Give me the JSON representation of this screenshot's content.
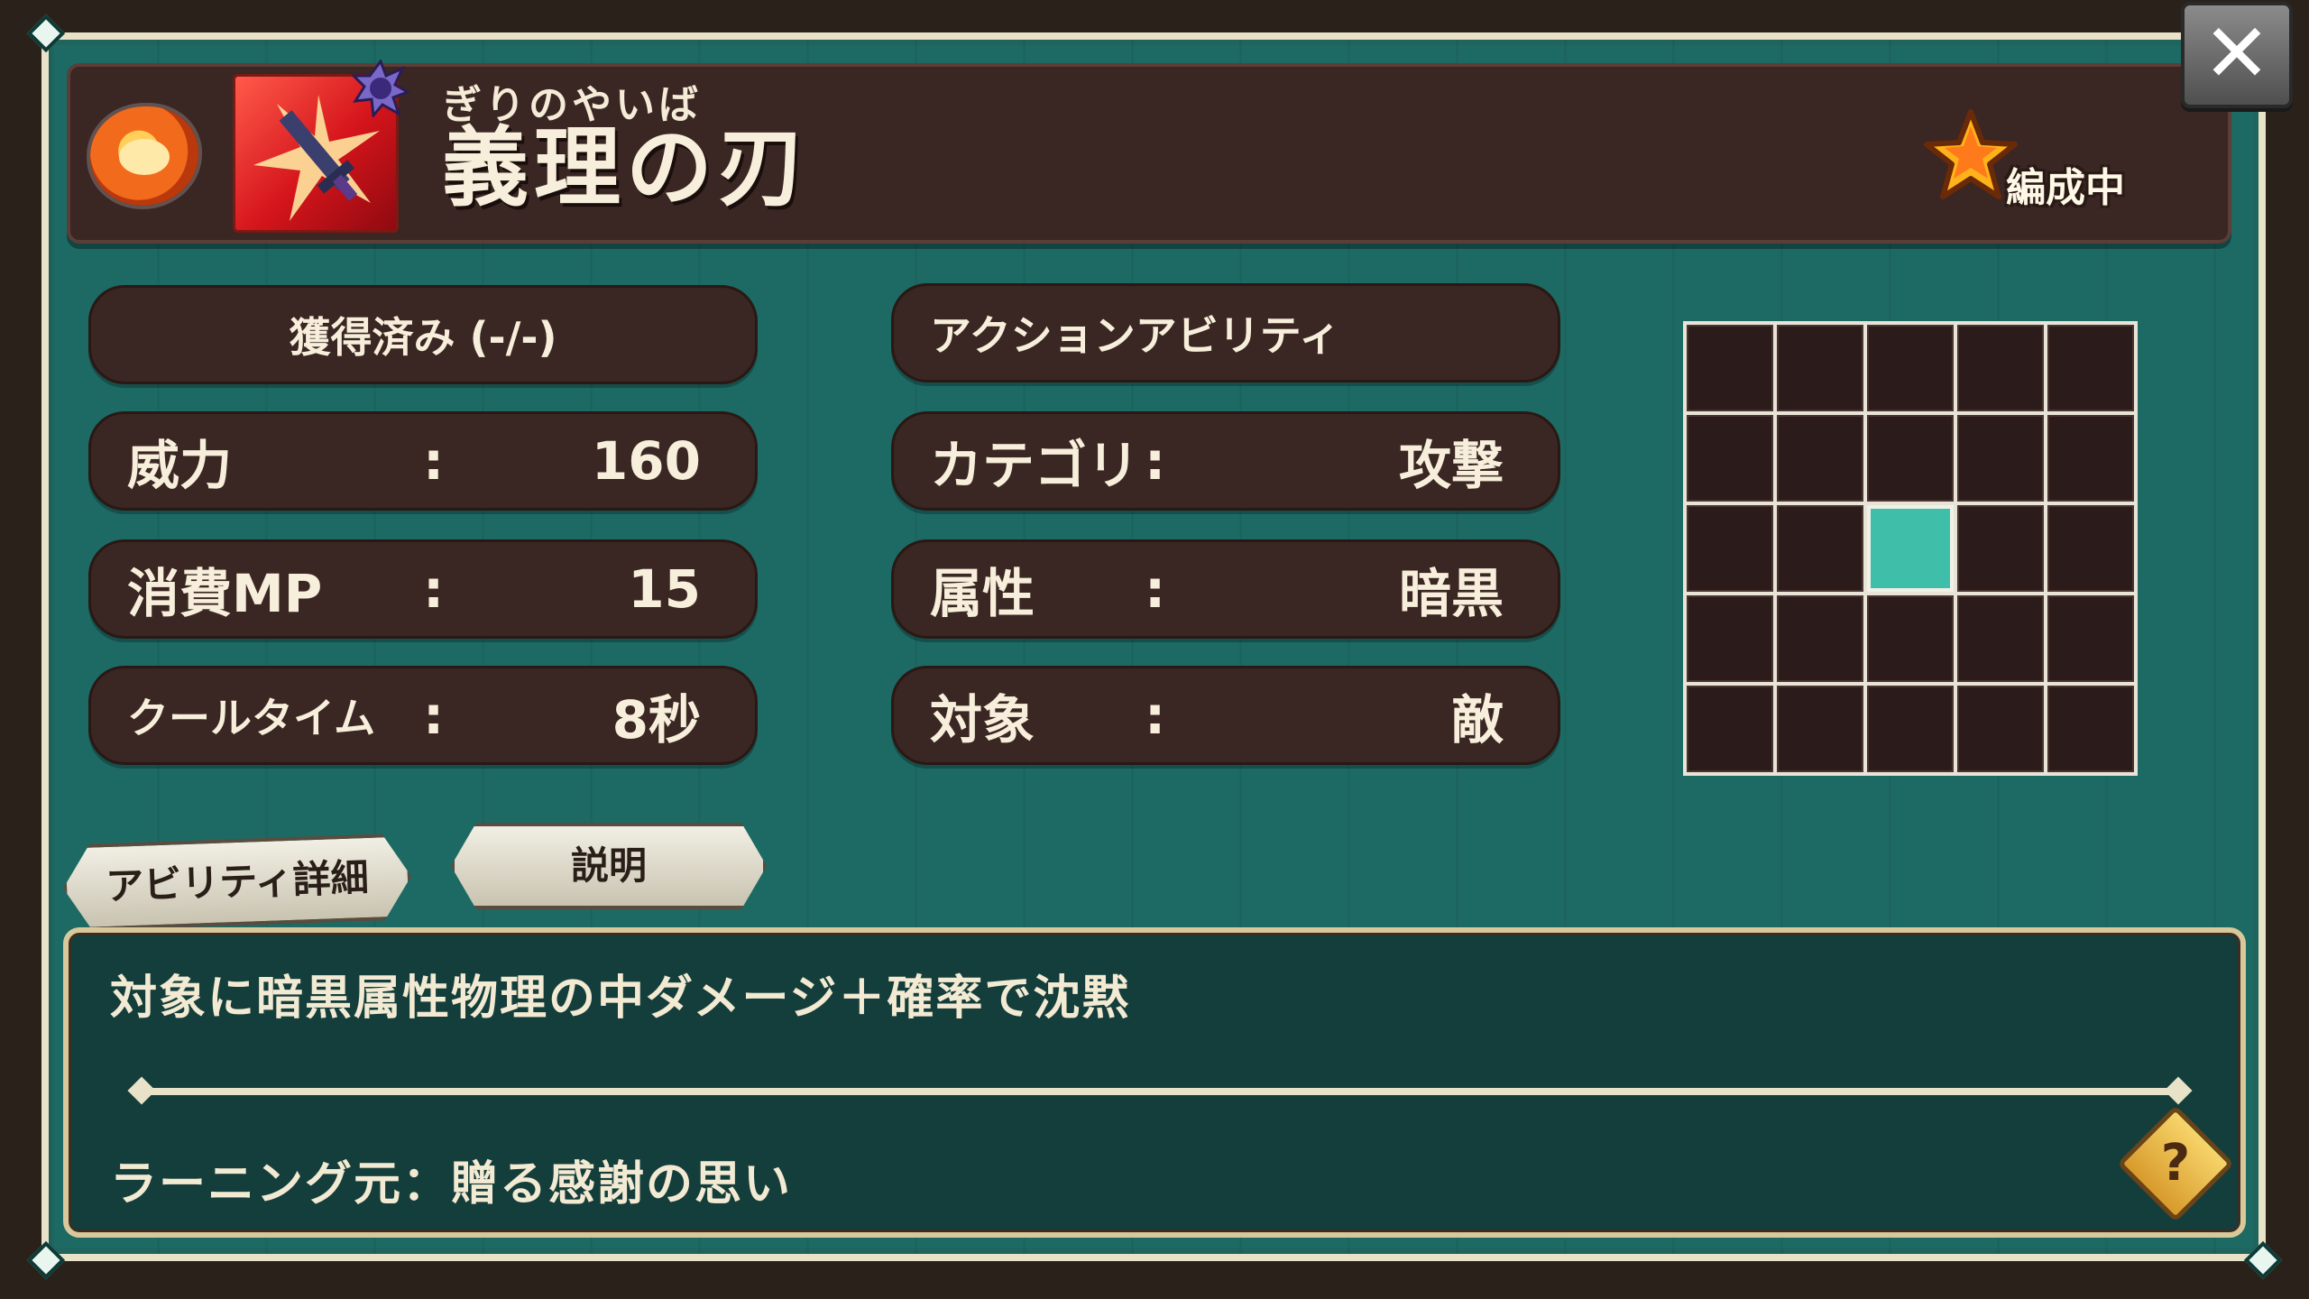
{
  "header": {
    "reading": "ぎりのやいば",
    "title": "義理の刃",
    "equipped_label": "編成中",
    "lion_icon": "lion-icon",
    "skill_icon": "sword-skill-icon",
    "element_badge": "dark-element-icon",
    "star_icon": "star-icon"
  },
  "close_button": {
    "glyph": "✕"
  },
  "stats_left": {
    "acquired": "獲得済み (-/-)",
    "power_label": "威力",
    "power_value": "160",
    "mp_label": "消費MP",
    "mp_value": "15",
    "cooldown_label": "クールタイム",
    "cooldown_value": "8秒",
    "colon": ":"
  },
  "stats_right": {
    "ability_type": "アクションアビリティ",
    "category_label": "カテゴリ",
    "category_value": "攻撃",
    "attribute_label": "属性",
    "attribute_value": "暗黒",
    "target_label": "対象",
    "target_value": "敵",
    "colon": ":"
  },
  "range_grid": {
    "rows": 5,
    "cols": 5,
    "active_cells": [
      [
        2,
        2
      ]
    ],
    "active_color": "#3fbfa9",
    "cell_color": "#2b1b1a"
  },
  "tabs": {
    "ability_detail": "アビリティ詳細",
    "description": "説明"
  },
  "description": {
    "text": "対象に暗黒属性物理の中ダメージ＋確率で沈黙",
    "learning_source": "ラーニング元：贈る感謝の思い",
    "help_glyph": "?"
  },
  "colors": {
    "panel": "#1f6f69",
    "pill": "#3a2623",
    "text": "#f7efdb"
  }
}
